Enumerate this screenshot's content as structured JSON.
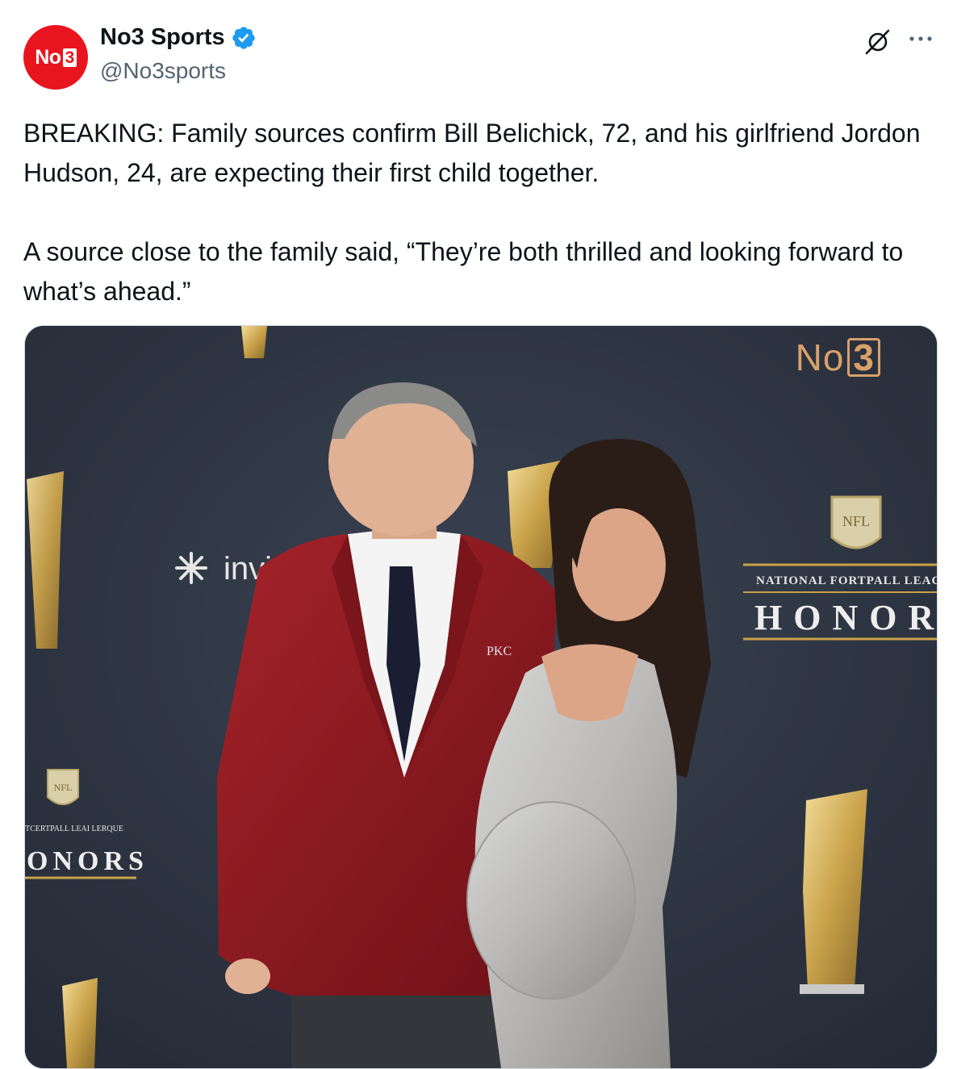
{
  "author": {
    "avatar_text": "No",
    "avatar_box": "3",
    "display_name": "No3 Sports",
    "handle": "@No3sports",
    "verified": true,
    "accent_color": "#e8141e"
  },
  "actions": {
    "grok_icon": "grok-icon",
    "more_icon": "more-icon"
  },
  "tweet": {
    "paragraph_1": "BREAKING: Family sources confirm Bill Belichick, 72, and his girlfriend Jordon Hudson, 24, are expecting their first child together.",
    "paragraph_2": "A source close to the family said, “They’re both thrilled and looking forward to what’s ahead.”"
  },
  "media": {
    "watermark_text": "No",
    "watermark_box": "3",
    "backdrop": {
      "sponsor": "invisali",
      "league_line": "NATIONAL FORTPALL LEAGU",
      "honors": "HONORS",
      "left_league_line": "TCERTPALL LEAI LERQUE",
      "left_honors": "ONORS",
      "shield_text": "NFL",
      "pocket_text": "PKC"
    }
  }
}
